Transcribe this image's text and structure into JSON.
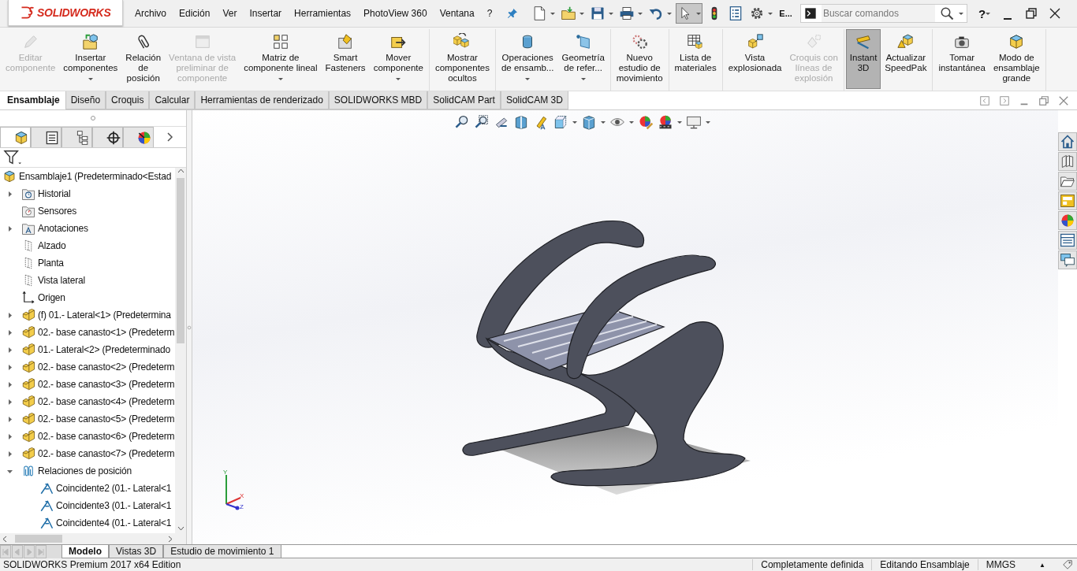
{
  "title_bar": {
    "logo": "SOLIDWORKS",
    "menu": [
      "Archivo",
      "Edición",
      "Ver",
      "Insertar",
      "Herramientas",
      "PhotoView 360",
      "Ventana",
      "?"
    ],
    "quick_access": [
      {
        "has_menu": true,
        "selected": false
      },
      {
        "has_menu": true,
        "selected": false
      },
      {
        "has_menu": true,
        "selected": false
      },
      {
        "has_menu": true,
        "selected": false
      },
      {
        "has_menu": true,
        "selected": false
      },
      {
        "has_menu": true,
        "selected": true
      },
      {
        "has_menu": false,
        "selected": false
      },
      {
        "has_menu": false,
        "selected": false
      },
      {
        "has_menu": true,
        "selected": false
      }
    ],
    "overflow_label": "E...",
    "search": {
      "placeholder": "Buscar comandos"
    },
    "help": "?"
  },
  "ribbon": {
    "groups": [
      [
        {
          "label": "Editar\ncomponente",
          "disabled": true,
          "has_menu": false,
          "selected": false
        },
        {
          "label": "Insertar\ncomponentes",
          "disabled": false,
          "has_menu": true,
          "selected": false
        },
        {
          "label": "Relación\nde\nposición",
          "disabled": false,
          "has_menu": false,
          "selected": false
        },
        {
          "label": "Ventana de vista\npreliminar de\ncomponente",
          "disabled": true,
          "has_menu": false,
          "selected": false
        },
        {
          "label": "Matriz de\ncomponente lineal",
          "disabled": false,
          "has_menu": true,
          "selected": false
        },
        {
          "label": "Smart\nFasteners",
          "disabled": false,
          "has_menu": false,
          "selected": false
        },
        {
          "label": "Mover\ncomponente",
          "disabled": false,
          "has_menu": true,
          "selected": false
        }
      ],
      [
        {
          "label": "Mostrar\ncomponentes\nocultos",
          "disabled": false,
          "has_menu": false,
          "selected": false
        }
      ],
      [
        {
          "label": "Operaciones\nde ensamb...",
          "disabled": false,
          "has_menu": true,
          "selected": false
        },
        {
          "label": "Geometría\nde refer...",
          "disabled": false,
          "has_menu": true,
          "selected": false
        }
      ],
      [
        {
          "label": "Nuevo\nestudio de\nmovimiento",
          "disabled": false,
          "has_menu": false,
          "selected": false
        }
      ],
      [
        {
          "label": "Lista de\nmateriales",
          "disabled": false,
          "has_menu": false,
          "selected": false
        }
      ],
      [
        {
          "label": "Vista\nexplosionada",
          "disabled": false,
          "has_menu": false,
          "selected": false
        },
        {
          "label": "Croquis con\nlíneas de\nexplosión",
          "disabled": true,
          "has_menu": false,
          "selected": false
        }
      ],
      [
        {
          "label": "Instant\n3D",
          "disabled": false,
          "has_menu": false,
          "selected": true
        },
        {
          "label": "Actualizar\nSpeedPak",
          "disabled": false,
          "has_menu": false,
          "selected": false
        }
      ],
      [
        {
          "label": "Tomar\ninstantánea",
          "disabled": false,
          "has_menu": false,
          "selected": false
        },
        {
          "label": "Modo de\nensamblaje\ngrande",
          "disabled": false,
          "has_menu": false,
          "selected": false
        }
      ]
    ]
  },
  "tabs": [
    {
      "label": "Ensamblaje",
      "selected": true
    },
    {
      "label": "Diseño",
      "selected": false
    },
    {
      "label": "Croquis",
      "selected": false
    },
    {
      "label": "Calcular",
      "selected": false
    },
    {
      "label": "Herramientas de renderizado",
      "selected": false
    },
    {
      "label": "SOLIDWORKS MBD",
      "selected": false
    },
    {
      "label": "SolidCAM Part",
      "selected": false
    },
    {
      "label": "SolidCAM 3D",
      "selected": false
    }
  ],
  "left_panel": {
    "tabs": [
      {
        "selected": true
      },
      {
        "selected": false
      },
      {
        "selected": false
      },
      {
        "selected": false
      },
      {
        "selected": false
      }
    ],
    "tree": {
      "label": "Ensamblaje1  (Predeterminado<Estad",
      "kind": "assembly",
      "children": [
        {
          "label": "Historial",
          "kind": "history",
          "expanded": false
        },
        {
          "label": "Sensores",
          "kind": "sensor"
        },
        {
          "label": "Anotaciones",
          "kind": "annotation",
          "expanded": false
        },
        {
          "label": "Alzado",
          "kind": "plane"
        },
        {
          "label": "Planta",
          "kind": "plane"
        },
        {
          "label": "Vista lateral",
          "kind": "plane"
        },
        {
          "label": "Origen",
          "kind": "origin"
        },
        {
          "label": "(f) 01.- Lateral<1> (Predetermina",
          "kind": "part",
          "expanded": false
        },
        {
          "label": "02.- base canasto<1> (Predeterm",
          "kind": "part",
          "expanded": false
        },
        {
          "label": "01.- Lateral<2> (Predeterminado",
          "kind": "part",
          "expanded": false
        },
        {
          "label": "02.- base canasto<2> (Predeterm",
          "kind": "part",
          "expanded": false
        },
        {
          "label": "02.- base canasto<3> (Predeterm",
          "kind": "part",
          "expanded": false
        },
        {
          "label": "02.- base canasto<4> (Predeterm",
          "kind": "part",
          "expanded": false
        },
        {
          "label": "02.- base canasto<5> (Predeterm",
          "kind": "part",
          "expanded": false
        },
        {
          "label": "02.- base canasto<6> (Predeterm",
          "kind": "part",
          "expanded": false
        },
        {
          "label": "02.- base canasto<7> (Predeterm",
          "kind": "part",
          "expanded": false
        },
        {
          "label": "Relaciones de posición",
          "kind": "mates",
          "expanded": true,
          "children": [
            {
              "label": "Coincidente2 (01.- Lateral<1",
              "kind": "mate"
            },
            {
              "label": "Coincidente3 (01.- Lateral<1",
              "kind": "mate"
            },
            {
              "label": "Coincidente4 (01.- Lateral<1",
              "kind": "mate"
            }
          ]
        }
      ]
    }
  },
  "viewport": {
    "triad": [
      "Y",
      "X",
      "Z"
    ]
  },
  "bottom_tabs": [
    {
      "label": "Modelo",
      "selected": true
    },
    {
      "label": "Vistas 3D",
      "selected": false
    },
    {
      "label": "Estudio de movimiento 1",
      "selected": false
    }
  ],
  "status_bar": {
    "edition": "SOLIDWORKS Premium 2017 x64 Edition",
    "fields": [
      "Completamente definida",
      "Editando Ensamblaje",
      "MMGS"
    ],
    "arrow": "▲"
  }
}
